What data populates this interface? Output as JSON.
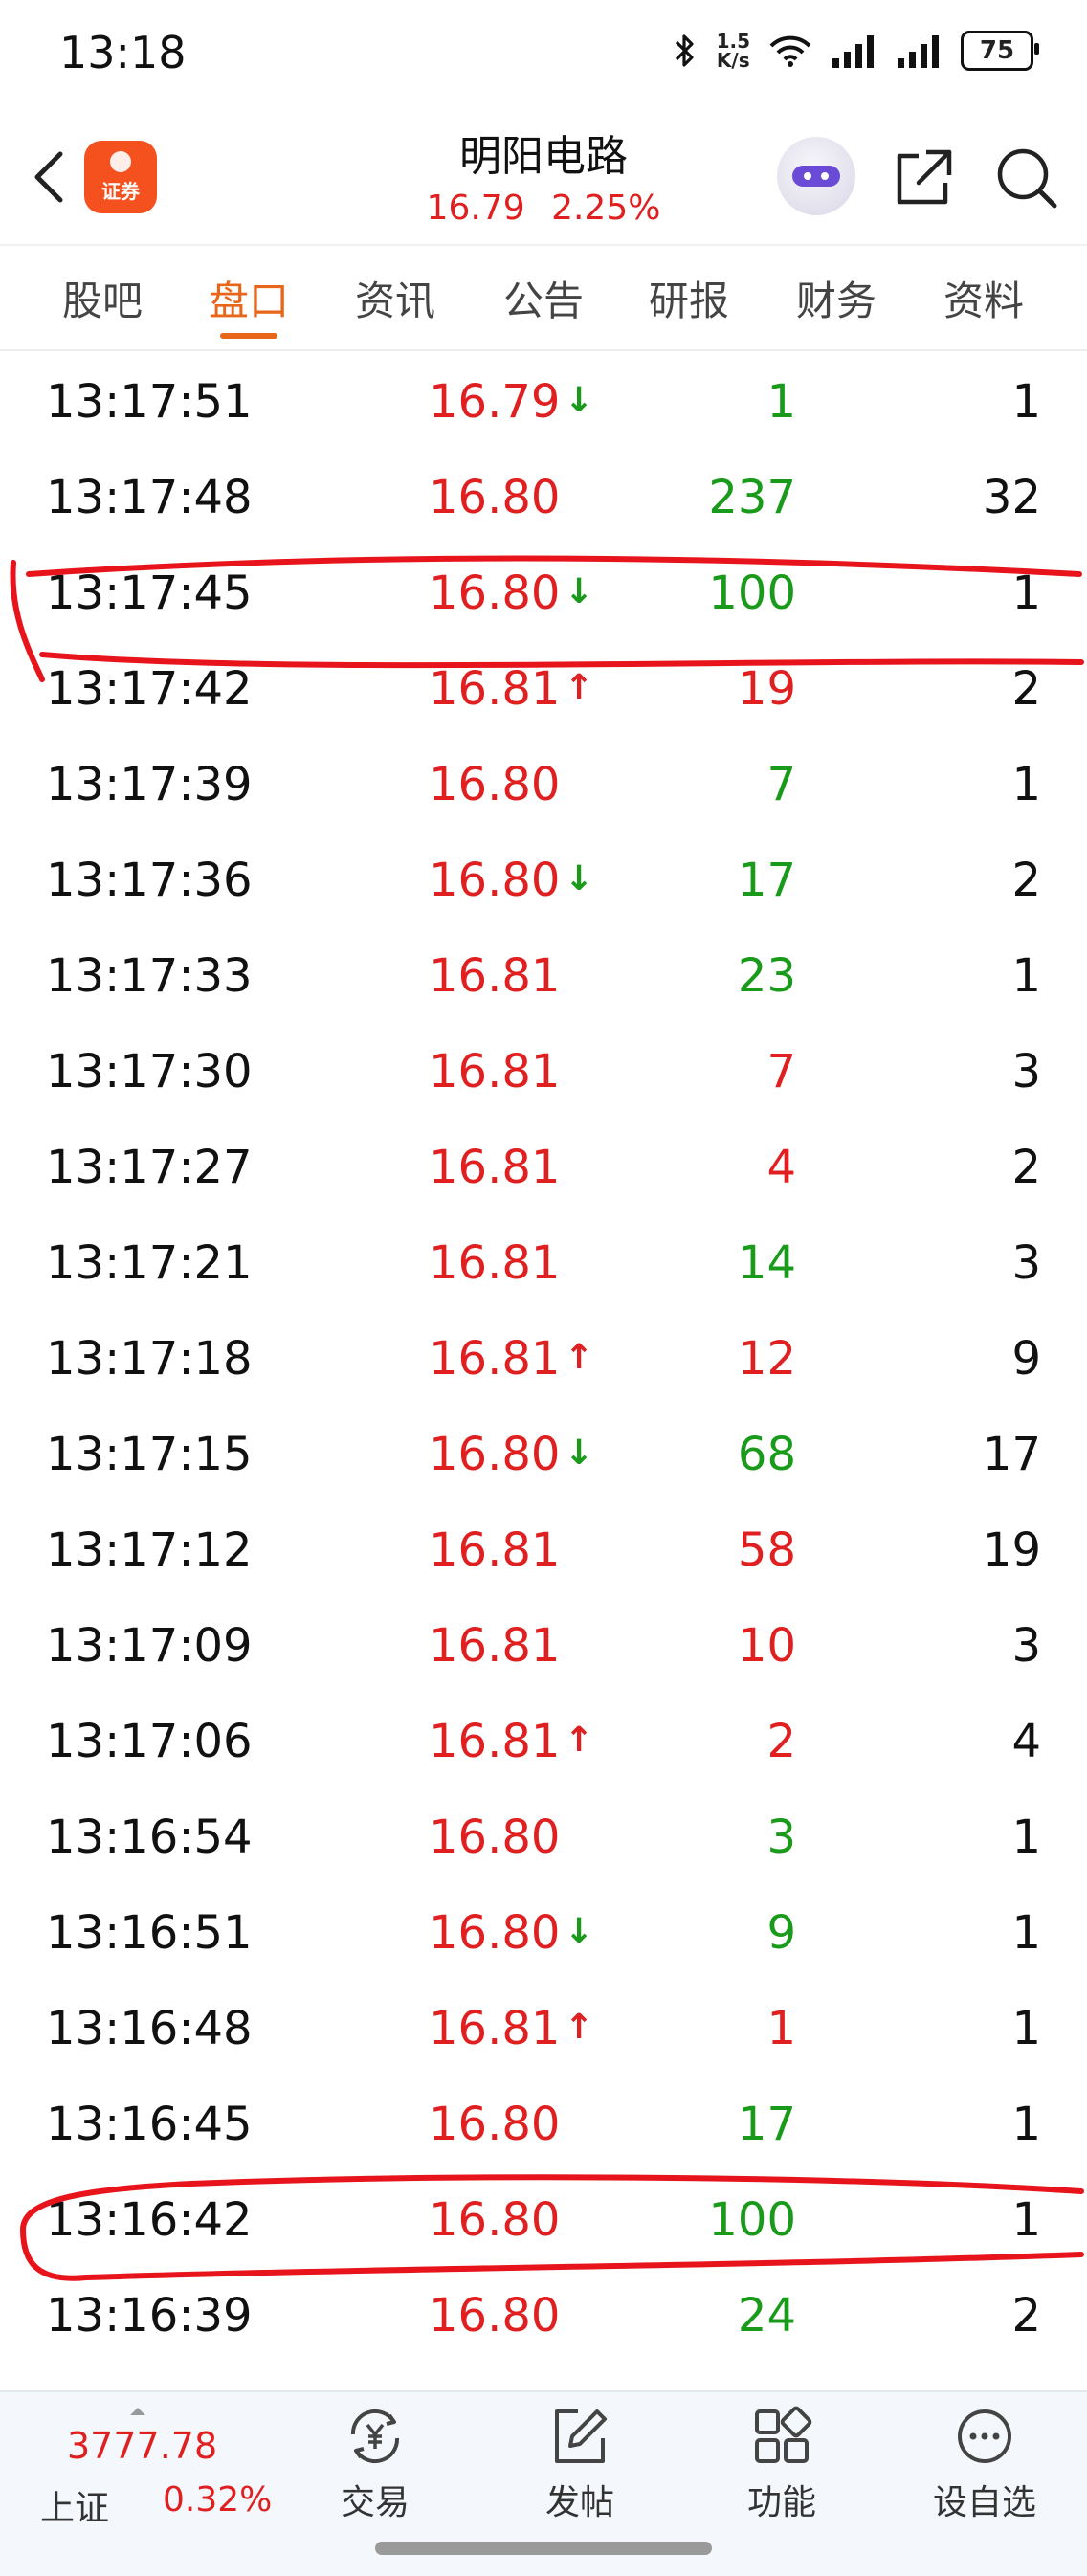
{
  "status_bar": {
    "time": "13:18",
    "net_speed_value": "1.5",
    "net_speed_unit": "K/s",
    "battery": "75",
    "icons": [
      "bluetooth-icon",
      "wifi-icon",
      "signal-icon",
      "signal-icon",
      "battery-icon"
    ]
  },
  "header": {
    "logo_text": "证券",
    "title": "明阳电路",
    "price": "16.79",
    "change_pct": "2.25%"
  },
  "tabs": [
    {
      "label": "股吧",
      "active": false
    },
    {
      "label": "盘口",
      "active": true
    },
    {
      "label": "资讯",
      "active": false
    },
    {
      "label": "公告",
      "active": false
    },
    {
      "label": "研报",
      "active": false
    },
    {
      "label": "财务",
      "active": false
    },
    {
      "label": "资料",
      "active": false
    }
  ],
  "ticks": [
    {
      "time": "13:17:51",
      "price": "16.79",
      "arrow": "↓",
      "volume": "1",
      "side": "sell",
      "count": "1"
    },
    {
      "time": "13:17:48",
      "price": "16.80",
      "arrow": "",
      "volume": "237",
      "side": "sell",
      "count": "32"
    },
    {
      "time": "13:17:45",
      "price": "16.80",
      "arrow": "↓",
      "volume": "100",
      "side": "sell",
      "count": "1"
    },
    {
      "time": "13:17:42",
      "price": "16.81",
      "arrow": "↑",
      "volume": "19",
      "side": "buy",
      "count": "2"
    },
    {
      "time": "13:17:39",
      "price": "16.80",
      "arrow": "",
      "volume": "7",
      "side": "sell",
      "count": "1"
    },
    {
      "time": "13:17:36",
      "price": "16.80",
      "arrow": "↓",
      "volume": "17",
      "side": "sell",
      "count": "2"
    },
    {
      "time": "13:17:33",
      "price": "16.81",
      "arrow": "",
      "volume": "23",
      "side": "sell",
      "count": "1"
    },
    {
      "time": "13:17:30",
      "price": "16.81",
      "arrow": "",
      "volume": "7",
      "side": "buy",
      "count": "3"
    },
    {
      "time": "13:17:27",
      "price": "16.81",
      "arrow": "",
      "volume": "4",
      "side": "buy",
      "count": "2"
    },
    {
      "time": "13:17:21",
      "price": "16.81",
      "arrow": "",
      "volume": "14",
      "side": "sell",
      "count": "3"
    },
    {
      "time": "13:17:18",
      "price": "16.81",
      "arrow": "↑",
      "volume": "12",
      "side": "buy",
      "count": "9"
    },
    {
      "time": "13:17:15",
      "price": "16.80",
      "arrow": "↓",
      "volume": "68",
      "side": "sell",
      "count": "17"
    },
    {
      "time": "13:17:12",
      "price": "16.81",
      "arrow": "",
      "volume": "58",
      "side": "buy",
      "count": "19"
    },
    {
      "time": "13:17:09",
      "price": "16.81",
      "arrow": "",
      "volume": "10",
      "side": "buy",
      "count": "3"
    },
    {
      "time": "13:17:06",
      "price": "16.81",
      "arrow": "↑",
      "volume": "2",
      "side": "buy",
      "count": "4"
    },
    {
      "time": "13:16:54",
      "price": "16.80",
      "arrow": "",
      "volume": "3",
      "side": "sell",
      "count": "1"
    },
    {
      "time": "13:16:51",
      "price": "16.80",
      "arrow": "↓",
      "volume": "9",
      "side": "sell",
      "count": "1"
    },
    {
      "time": "13:16:48",
      "price": "16.81",
      "arrow": "↑",
      "volume": "1",
      "side": "buy",
      "count": "1"
    },
    {
      "time": "13:16:45",
      "price": "16.80",
      "arrow": "",
      "volume": "17",
      "side": "sell",
      "count": "1"
    },
    {
      "time": "13:16:42",
      "price": "16.80",
      "arrow": "",
      "volume": "100",
      "side": "sell",
      "count": "1"
    },
    {
      "time": "13:16:39",
      "price": "16.80",
      "arrow": "",
      "volume": "24",
      "side": "sell",
      "count": "2"
    }
  ],
  "colors": {
    "up": "#e02020",
    "down": "#1a9a1a",
    "accent": "#e8661a",
    "annotation": "#e8141c"
  },
  "bottom_bar": {
    "index_value": "3777.78",
    "index_name": "上证",
    "index_change": "0.32%",
    "nav": [
      {
        "label": "交易",
        "icon": "trade-yuan-icon"
      },
      {
        "label": "发帖",
        "icon": "edit-post-icon"
      },
      {
        "label": "功能",
        "icon": "grid-apps-icon"
      },
      {
        "label": "设自选",
        "icon": "more-dots-icon"
      }
    ]
  }
}
